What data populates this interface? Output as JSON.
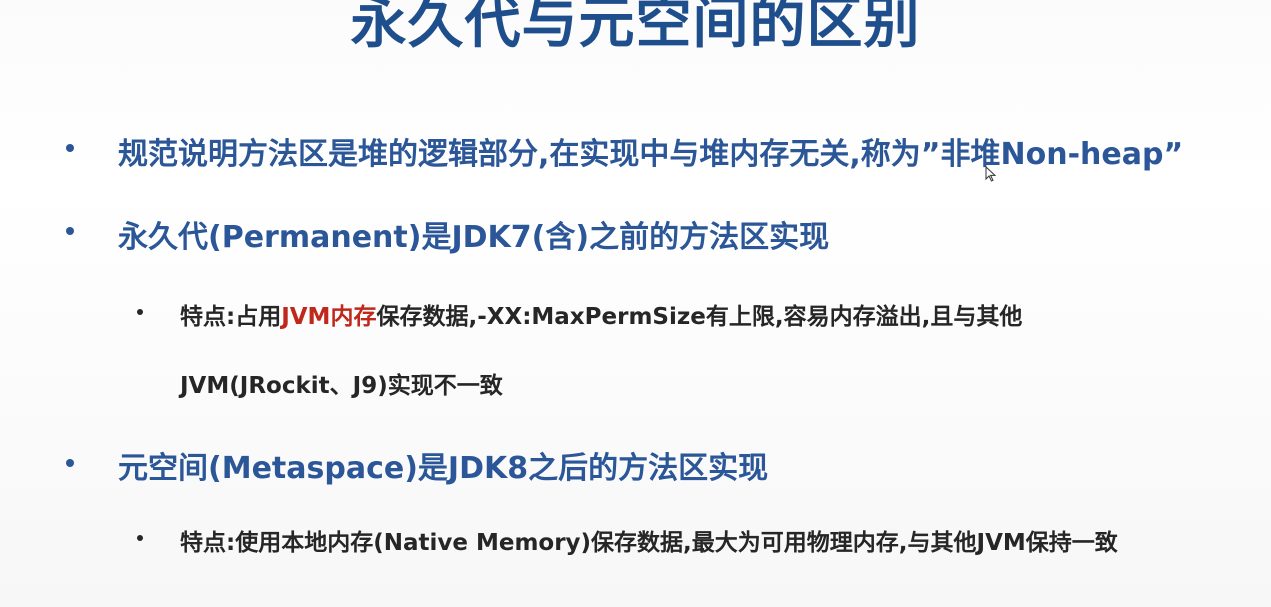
{
  "slide": {
    "title": "永久代与元空间的区别",
    "bullets": {
      "b1": "规范说明方法区是堆的逻辑部分,在实现中与堆内存无关,称为”非堆Non-heap”",
      "b2": "永久代(Permanent)是JDK7(含)之前的方法区实现",
      "b2_sub1": {
        "prefix": "特点:占用",
        "highlight": "JVM内存",
        "suffix": "保存数据,-XX:MaxPermSize有上限,容易内存溢出,且与其他",
        "line2": "JVM(JRockit、J9)实现不一致"
      },
      "b3": "元空间(Metaspace)是JDK8之后的方法区实现",
      "b3_sub1": "特点:使用本地内存(Native Memory)保存数据,最大为可用物理内存,与其他JVM保持一致"
    },
    "colors": {
      "title": "#1f4e8c",
      "level1": "#2b5698",
      "level2": "#262626",
      "highlight": "#c0281c"
    }
  }
}
